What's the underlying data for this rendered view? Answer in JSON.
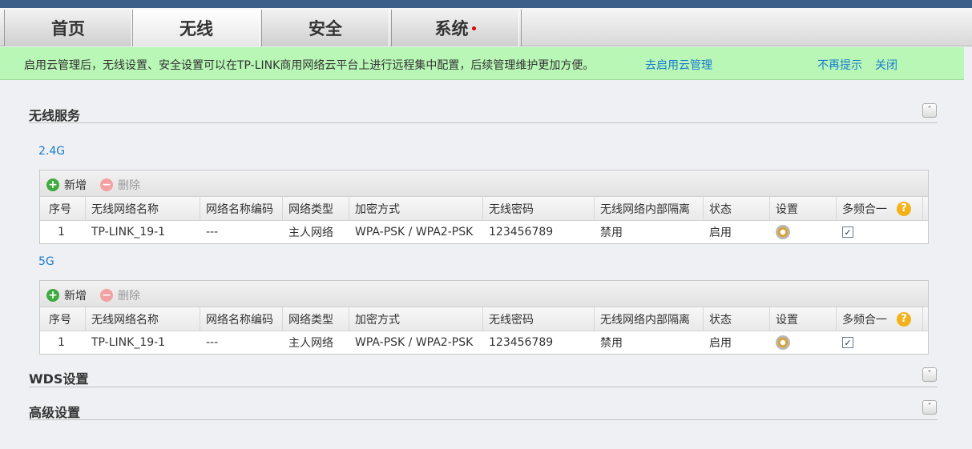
{
  "tabs": [
    {
      "label": "首页",
      "active": false
    },
    {
      "label": "无线",
      "active": true
    },
    {
      "label": "安全",
      "active": false
    },
    {
      "label": "系统",
      "active": false,
      "badge": true
    }
  ],
  "notice": {
    "message": "启用云管理后，无线设置、安全设置可以在TP-LINK商用网络云平台上进行远程集中配置，后续管理维护更加方便。",
    "enable_link": "去启用云管理",
    "dismiss_link": "不再提示",
    "close_link": "关闭"
  },
  "sections": {
    "wireless_service": {
      "title": "无线服务",
      "toggle": "˄"
    },
    "wds": {
      "title": "WDS设置",
      "toggle": "˅"
    },
    "advanced": {
      "title": "高级设置",
      "toggle": "˅"
    }
  },
  "toolbar": {
    "add_label": "新增",
    "delete_label": "删除",
    "add_icon": "+",
    "delete_icon": "−"
  },
  "columns": [
    "序号",
    "无线网络名称",
    "网络名称编码",
    "网络类型",
    "加密方式",
    "无线密码",
    "无线网络内部隔离",
    "状态",
    "设置",
    "多频合一"
  ],
  "help_icon": "?",
  "bands": [
    {
      "label": "2.4G",
      "rows": [
        {
          "index": "1",
          "ssid": "TP-LINK_19-1",
          "encoding": "---",
          "type": "主人网络",
          "security": "WPA-PSK / WPA2-PSK",
          "password": "123456789",
          "isolation": "禁用",
          "status": "启用",
          "multiband_checked": "✓"
        }
      ]
    },
    {
      "label": "5G",
      "rows": [
        {
          "index": "1",
          "ssid": "TP-LINK_19-1",
          "encoding": "---",
          "type": "主人网络",
          "security": "WPA-PSK / WPA2-PSK",
          "password": "123456789",
          "isolation": "禁用",
          "status": "启用",
          "multiband_checked": "✓"
        }
      ]
    }
  ]
}
